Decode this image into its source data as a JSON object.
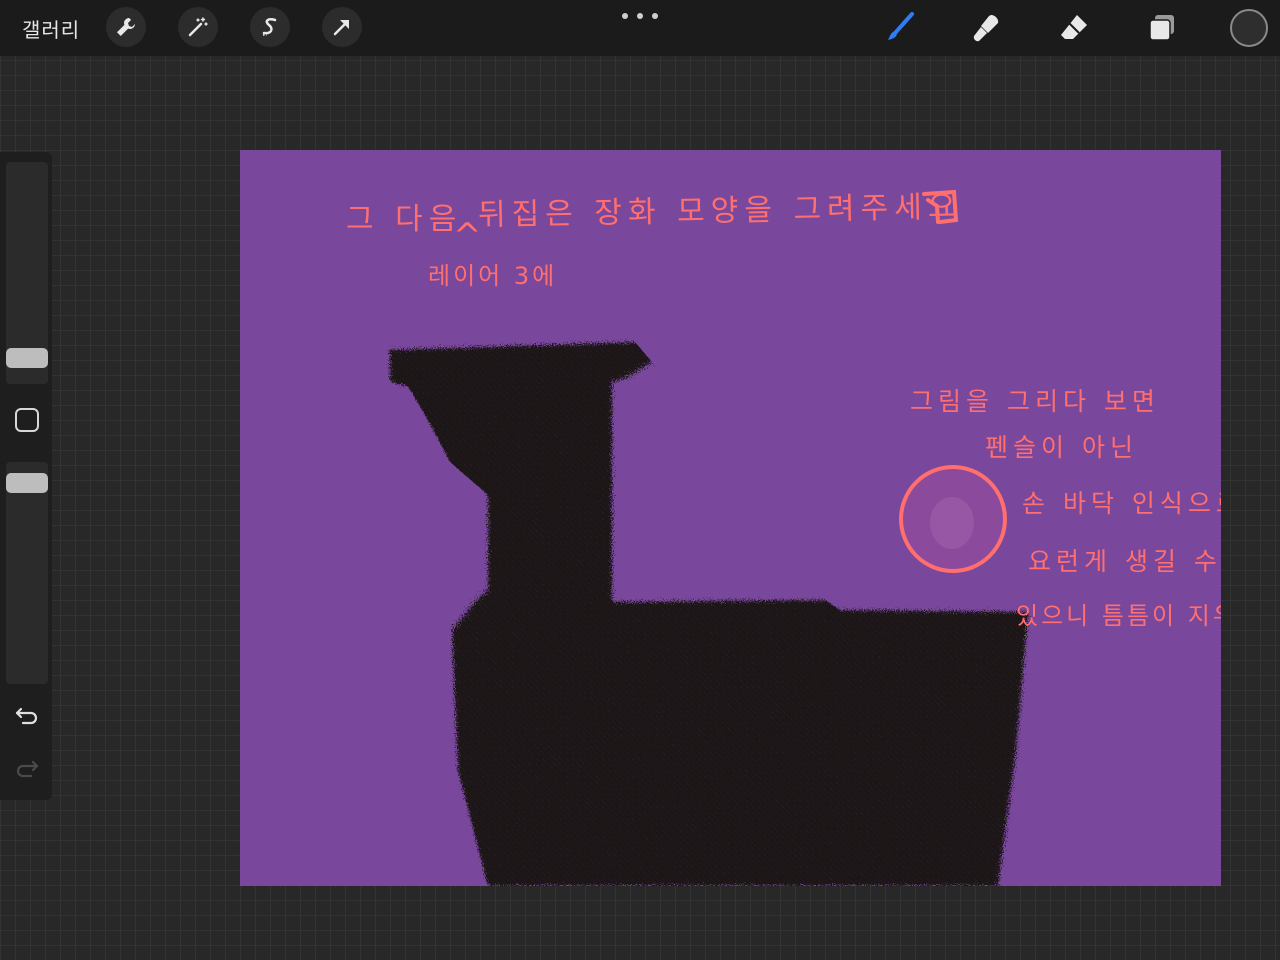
{
  "topbar": {
    "gallery_label": "갤러리",
    "left_tools": [
      "wrench-icon",
      "magic-wand-icon",
      "selection-s-icon",
      "transform-arrow-icon"
    ],
    "right_tools": [
      "brush-icon",
      "smudge-icon",
      "eraser-icon",
      "layers-icon"
    ],
    "active_tool": "brush",
    "active_tool_color": "#2f7df6",
    "current_color": "#2e2e2e"
  },
  "sidebar": {
    "brush_size_level": 0.15,
    "opacity_level": 0.95
  },
  "canvas": {
    "background_color": "#79479b",
    "ink_color": "#1a1719",
    "annotation_color": "#ff6f6f",
    "notes": {
      "line1_a": "그 다음",
      "line1_b": "뒤집은 장화 모양을 그려주세요",
      "caret": "^",
      "insert": "레이어 3에",
      "side1": "그림을 그리다 보면",
      "side2": "펜슬이 아닌",
      "side3": "손 바닥 인식으로",
      "side4": "요런게 생길 수",
      "side5": "있으니 틈틈이 지우기"
    }
  }
}
